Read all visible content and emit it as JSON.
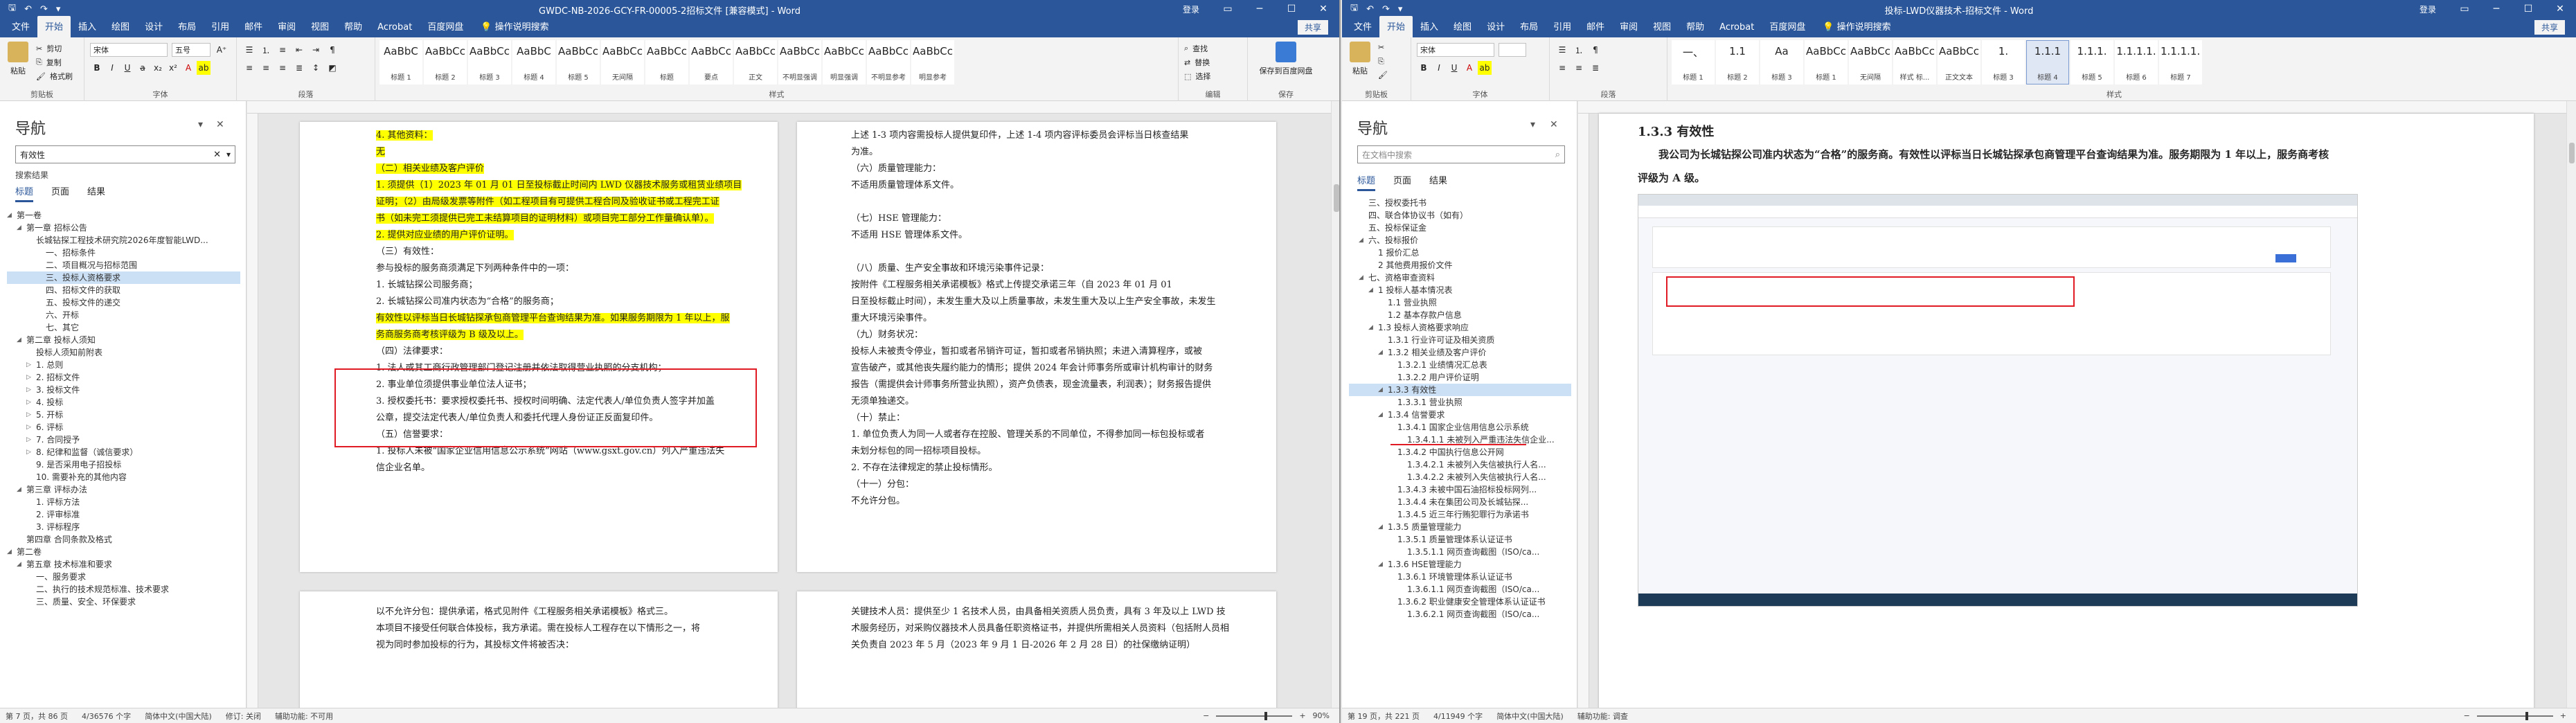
{
  "left": {
    "title": "GWDC-NB-2026-GCY-FR-00005-2招标文件 [兼容模式] - Word",
    "signin": "登录",
    "share": "共享",
    "menu_tabs": [
      "文件",
      "开始",
      "插入",
      "绘图",
      "设计",
      "布局",
      "引用",
      "邮件",
      "审阅",
      "视图",
      "帮助",
      "Acrobat",
      "百度网盘"
    ],
    "tell_me": "操作说明搜索",
    "ribbon": {
      "paste": "粘贴",
      "cut": "剪切",
      "copy": "复制",
      "format_painter": "格式刷",
      "clipboard": "剪贴板",
      "font_name": "宋体",
      "font_size": "五号",
      "font": "字体",
      "paragraph": "段落",
      "styles_label": "样式",
      "editing_label": "编辑",
      "find": "查找",
      "replace": "替换",
      "select": "选择",
      "save_baidu": "保存到百度网盘",
      "save_group": "保存",
      "styles": [
        {
          "preview": "AaBbC",
          "name": "标题 1"
        },
        {
          "preview": "AaBbCcI",
          "name": "标题 2"
        },
        {
          "preview": "AaBbCc",
          "name": "标题 3"
        },
        {
          "preview": "AaBbC",
          "name": "标题 4"
        },
        {
          "preview": "AaBbCcDd",
          "name": "标题 5"
        },
        {
          "preview": "AaBbCcI",
          "name": "无间隔"
        },
        {
          "preview": "AaBbCcDd",
          "name": "标题"
        },
        {
          "preview": "AaBbCcDd",
          "name": "要点"
        },
        {
          "preview": "AaBbCcDd",
          "name": "正文"
        },
        {
          "preview": "AaBbCcDd",
          "name": "不明显强调"
        },
        {
          "preview": "AaBbCcDd",
          "name": "明显强调"
        },
        {
          "preview": "AaBbCcDd",
          "name": "不明显参考"
        },
        {
          "preview": "AaBbCcDd",
          "name": "明显参考"
        }
      ]
    },
    "nav": {
      "title": "导航",
      "search": "有效性",
      "result": "搜索结果",
      "tabs": [
        "标题",
        "页面",
        "结果"
      ],
      "items": [
        {
          "t": "第一卷",
          "lvl": 0,
          "c": "◢"
        },
        {
          "t": "第一章 招标公告",
          "lvl": 1,
          "c": "◢"
        },
        {
          "t": "长城钻探工程技术研究院2026年度智能LWD...",
          "lvl": 2,
          "c": ""
        },
        {
          "t": "一、招标条件",
          "lvl": 3,
          "c": ""
        },
        {
          "t": "二、项目概况与招标范围",
          "lvl": 3,
          "c": ""
        },
        {
          "t": "三、投标人资格要求",
          "lvl": 3,
          "c": "",
          "hl": true
        },
        {
          "t": "四、招标文件的获取",
          "lvl": 3,
          "c": ""
        },
        {
          "t": "五、投标文件的递交",
          "lvl": 3,
          "c": ""
        },
        {
          "t": "六、开标",
          "lvl": 3,
          "c": ""
        },
        {
          "t": "七、其它",
          "lvl": 3,
          "c": ""
        },
        {
          "t": "第二章 投标人须知",
          "lvl": 1,
          "c": "◢"
        },
        {
          "t": "投标人须知前附表",
          "lvl": 2,
          "c": ""
        },
        {
          "t": "1. 总则",
          "lvl": 2,
          "c": "▷"
        },
        {
          "t": "2. 招标文件",
          "lvl": 2,
          "c": "▷"
        },
        {
          "t": "3. 投标文件",
          "lvl": 2,
          "c": "▷"
        },
        {
          "t": "4. 投标",
          "lvl": 2,
          "c": "▷"
        },
        {
          "t": "5. 开标",
          "lvl": 2,
          "c": "▷"
        },
        {
          "t": "6. 评标",
          "lvl": 2,
          "c": "▷"
        },
        {
          "t": "7. 合同授予",
          "lvl": 2,
          "c": "▷"
        },
        {
          "t": "8. 纪律和监督（诚信要求）",
          "lvl": 2,
          "c": "▷"
        },
        {
          "t": "9. 是否采用电子招投标",
          "lvl": 2,
          "c": ""
        },
        {
          "t": "10. 需要补充的其他内容",
          "lvl": 2,
          "c": ""
        },
        {
          "t": "第三章 评标办法",
          "lvl": 1,
          "c": "◢"
        },
        {
          "t": "1. 评标方法",
          "lvl": 2,
          "c": ""
        },
        {
          "t": "2. 评审标准",
          "lvl": 2,
          "c": ""
        },
        {
          "t": "3. 评标程序",
          "lvl": 2,
          "c": ""
        },
        {
          "t": "第四章 合同条款及格式",
          "lvl": 1,
          "c": ""
        },
        {
          "t": "第二卷",
          "lvl": 0,
          "c": "◢"
        },
        {
          "t": "第五章 技术标准和要求",
          "lvl": 1,
          "c": "◢"
        },
        {
          "t": "一、服务要求",
          "lvl": 2,
          "c": ""
        },
        {
          "t": "二、执行的技术规范标准、技术要求",
          "lvl": 2,
          "c": ""
        },
        {
          "t": "三、质量、安全、环保要求",
          "lvl": 2,
          "c": ""
        }
      ]
    },
    "page1": [
      {
        "t": "4. 其他资料：",
        "c": "yel"
      },
      {
        "t": "无",
        "c": "yel"
      },
      {
        "t": "（二）相关业绩及客户评价",
        "c": "yel"
      },
      {
        "t": "1. 须提供（1）2023 年 01 月 01 日至投标截止时间内 LWD 仪器技术服务或租赁业绩项目",
        "c": "yel"
      },
      {
        "t": "证明；（2）由局级发票等附件（如工程项目有可提供工程合同及验收证书或工程完工证",
        "c": "yel"
      },
      {
        "t": "书（如未完工须提供已完工未结算项目的证明材料）或项目完工部分工作量确认单）。",
        "c": "yel"
      },
      {
        "t": "2. 提供对应业绩的用户评价证明。",
        "c": "yel"
      },
      {
        "t": "（三）有效性：",
        "c": ""
      },
      {
        "t": "参与投标的服务商须满足下列两种条件中的一项：",
        "c": ""
      },
      {
        "t": "1. 长城钻探公司服务商；",
        "c": ""
      },
      {
        "t": "2. 长城钻探公司准内状态为“合格”的服务商；",
        "c": ""
      },
      {
        "t": "有效性以评标当日长城钻探承包商管理平台查询结果为准。如果服务期限为 1 年以上，服",
        "c": "yel"
      },
      {
        "t": "务商服务商考核评级为 B 级及以上。",
        "c": "yel"
      },
      {
        "t": "（四）法律要求：",
        "c": ""
      },
      {
        "t": "1. 法人或其工商行政管理部门登记注册并依法取得营业执照的分支机构；",
        "c": ""
      },
      {
        "t": "2. 事业单位须提供事业单位法人证书；",
        "c": ""
      },
      {
        "t": "3. 授权委托书：要求授权委托书、授权时间明确、法定代表人/单位负责人签字并加盖",
        "c": ""
      },
      {
        "t": "公章，提交法定代表人/单位负责人和委托代理人身份证正反面复印件。",
        "c": ""
      },
      {
        "t": "（五）信誉要求：",
        "c": ""
      },
      {
        "t": "1. 投标人未被“国家企业信用信息公示系统”网站（www.gsxt.gov.cn）列入严重违法失",
        "c": ""
      },
      {
        "t": "信企业名单。",
        "c": ""
      }
    ],
    "page2": [
      "上述 1-3 项内容需投标人提供复印件，上述 1-4 项内容评标委员会评标当日核查结果",
      "为准。",
      "（六）质量管理能力：",
      "不适用质量管理体系文件。",
      "",
      "（七）HSE 管理能力：",
      "不适用 HSE 管理体系文件。",
      "",
      "（八）质量、生产安全事故和环境污染事件记录：",
      "按附件《工程服务相关承诺模板》格式上传提交承诺三年（自 2023 年 01 月 01",
      "日至投标截止时间），未发生重大及以上质量事故，未发生重大及以上生产安全事故，未发生",
      "重大环境污染事件。",
      "（九）财务状况：",
      "投标人未被责令停业，暂扣或者吊销许可证，暂扣或者吊销执照；未进入清算程序，或被",
      "宣告破产，或其他丧失履约能力的情形；提供 2024 年会计师事务所或审计机构审计的财务",
      "报告（需提供会计师事务所营业执照），资产负债表，现金流量表，利润表）；财务报告提供",
      "无须单独递交。",
      "（十）禁止：",
      "1. 单位负责人为同一人或者存在控股、管理关系的不同单位，不得参加同一标包投标或者",
      "未划分标包的同一招标项目投标。",
      "2. 不存在法律规定的禁止投标情形。",
      "（十一）分包：",
      "不允许分包。"
    ],
    "page3": [
      "以不允许分包：提供承诺，格式见附件《工程服务相关承诺模板》格式三。",
      "本项目不接受任何联合体投标，我方承诺。需在投标人工程存在以下情形之一，将",
      "视为同时参加投标的行为，其投标文件将被否决："
    ],
    "page4": [
      "关键技术人员：提供至少 1 名技术人员，由具备相关资质人员负责，具有 3 年及以上 LWD 技",
      "术服务经历，对采购仪器技术人员具备任职资格证书，并提供所需相关人员资料（包括附人员相",
      "关负责自 2023 年 5 月（2023 年 9 月 1 日-2026 年 2 月 28 日）的社保缴纳证明）"
    ],
    "status": {
      "page": "第 7 页，共 86 页",
      "words": "4/36576 个字",
      "lang": "简体中文(中国大陆)",
      "track": "修订: 关闭",
      "access": "辅助功能: 不可用",
      "zoom": "90%"
    }
  },
  "right": {
    "title": "投标-LWD仪器技术-招标文件 - Word",
    "menu_tabs": [
      "文件",
      "开始",
      "插入",
      "绘图",
      "设计",
      "布局",
      "引用",
      "邮件",
      "审阅",
      "视图",
      "帮助",
      "Acrobat",
      "百度网盘"
    ],
    "tell_me": "操作说明搜索",
    "ribbon": {
      "font_name": "宋体",
      "font_size": "",
      "styles": [
        {
          "preview": "一、",
          "name": "标题 1"
        },
        {
          "preview": "1.1",
          "name": "标题 2"
        },
        {
          "preview": "Aa",
          "name": "标题 3"
        },
        {
          "preview": "AaBbCcDd",
          "name": "标题 1"
        },
        {
          "preview": "AaBbCcI",
          "name": "无间隔"
        },
        {
          "preview": "AaBbCcDd",
          "name": "样式 标..."
        },
        {
          "preview": "AaBbCcDd",
          "name": "正文文本"
        },
        {
          "preview": "1.",
          "name": "标题 3"
        },
        {
          "preview": "1.1.1",
          "name": "标题 4",
          "sel": true
        },
        {
          "preview": "1.1.1.",
          "name": "标题 5"
        },
        {
          "preview": "1.1.1.1.",
          "name": "标题 6"
        },
        {
          "preview": "1.1.1.1.1",
          "name": "标题 7"
        }
      ]
    },
    "nav": {
      "title": "导航",
      "search": "在文档中搜索",
      "tabs": [
        "标题",
        "页面",
        "结果"
      ],
      "items": [
        {
          "t": "三、授权委托书",
          "lvl": 1,
          "c": ""
        },
        {
          "t": "四、联合体协议书（如有）",
          "lvl": 1,
          "c": ""
        },
        {
          "t": "五、投标保证金",
          "lvl": 1,
          "c": ""
        },
        {
          "t": "六、投标报价",
          "lvl": 1,
          "c": "◢"
        },
        {
          "t": "1 报价汇总",
          "lvl": 2,
          "c": ""
        },
        {
          "t": "2 其他费用报价文件",
          "lvl": 2,
          "c": ""
        },
        {
          "t": "七、资格审查资料",
          "lvl": 1,
          "c": "◢"
        },
        {
          "t": "1 投标人基本情况表",
          "lvl": 2,
          "c": "◢"
        },
        {
          "t": "1.1 营业执照",
          "lvl": 3,
          "c": ""
        },
        {
          "t": "1.2 基本存款户信息",
          "lvl": 3,
          "c": ""
        },
        {
          "t": "1.3 投标人资格要求响应",
          "lvl": 2,
          "c": "◢"
        },
        {
          "t": "1.3.1 行业许可证及相关资质",
          "lvl": 3,
          "c": ""
        },
        {
          "t": "1.3.2 相关业绩及客户评价",
          "lvl": 3,
          "c": "◢"
        },
        {
          "t": "1.3.2.1 业绩情况汇总表",
          "lvl": 4,
          "c": ""
        },
        {
          "t": "1.3.2.2 用户评价证明",
          "lvl": 4,
          "c": ""
        },
        {
          "t": "1.3.3 有效性",
          "lvl": 3,
          "c": "◢",
          "hl": true
        },
        {
          "t": "1.3.3.1 营业执照",
          "lvl": 4,
          "c": ""
        },
        {
          "t": "1.3.4 信誉要求",
          "lvl": 3,
          "c": "◢"
        },
        {
          "t": "1.3.4.1 国家企业信用信息公示系统",
          "lvl": 4,
          "c": ""
        },
        {
          "t": "1.3.4.1.1 未被列入严重违法失信企业...",
          "lvl": 5,
          "c": ""
        },
        {
          "t": "1.3.4.2 中国执行信息公开网",
          "lvl": 4,
          "c": ""
        },
        {
          "t": "1.3.4.2.1 未被列入失信被执行人名...",
          "lvl": 5,
          "c": ""
        },
        {
          "t": "1.3.4.2.2 未被列入失信被执行人名...",
          "lvl": 5,
          "c": ""
        },
        {
          "t": "1.3.4.3 未被中国石油招标投标网列...",
          "lvl": 4,
          "c": ""
        },
        {
          "t": "1.3.4.4 未在集团公司及长城钻探...",
          "lvl": 4,
          "c": ""
        },
        {
          "t": "1.3.4.5 近三年行贿犯罪行为承诺书",
          "lvl": 4,
          "c": ""
        },
        {
          "t": "1.3.5 质量管理能力",
          "lvl": 3,
          "c": "◢"
        },
        {
          "t": "1.3.5.1 质量管理体系认证证书",
          "lvl": 4,
          "c": ""
        },
        {
          "t": "1.3.5.1.1 网页查询截图（ISO/ca...",
          "lvl": 5,
          "c": ""
        },
        {
          "t": "1.3.6 HSE管理能力",
          "lvl": 3,
          "c": "◢"
        },
        {
          "t": "1.3.6.1 环境管理体系认证证书",
          "lvl": 4,
          "c": ""
        },
        {
          "t": "1.3.6.1.1 网页查询截图（ISO/ca...",
          "lvl": 5,
          "c": ""
        },
        {
          "t": "1.3.6.2 职业健康安全管理体系认证证书",
          "lvl": 4,
          "c": ""
        },
        {
          "t": "1.3.6.2.1 网页查询截图（ISO/ca...",
          "lvl": 5,
          "c": ""
        }
      ]
    },
    "heading": "1.3.3 有效性",
    "body1": "我公司为长城钻探公司准内状态为“合格”的服务商。有效性以评标当日长城钻探承包商管理平台查询结果为准。服务期限为 1 年以上，服务商考核",
    "body2": "评级为 A 级。",
    "status": {
      "page": "第 19 页，共 221 页",
      "words": "4/11949 个字",
      "lang": "简体中文(中国大陆)",
      "access": "辅助功能: 调查"
    }
  }
}
